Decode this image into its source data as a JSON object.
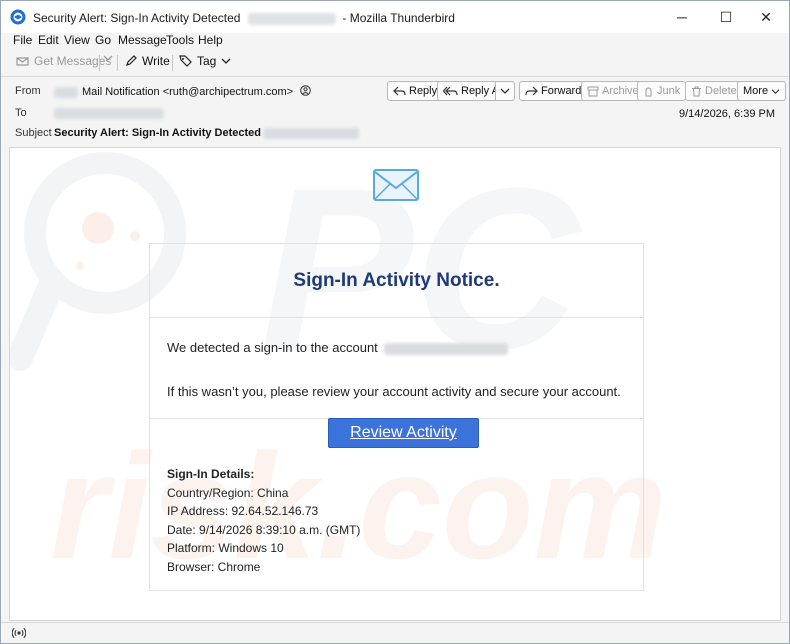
{
  "window": {
    "title_prefix": "Security Alert: Sign-In Activity Detected",
    "title_suffix": "- Mozilla Thunderbird",
    "controls": {
      "minimize": "─",
      "maximize": "☐",
      "close": "✕"
    }
  },
  "menubar": {
    "items": [
      "File",
      "Edit",
      "View",
      "Go",
      "Message",
      "Tools",
      "Help"
    ]
  },
  "toolbar": {
    "get_messages": "Get Messages",
    "write": "Write",
    "tag": "Tag"
  },
  "header": {
    "from_label": "From",
    "from_value": "Mail Notification <ruth@archipectrum.com>",
    "to_label": "To",
    "subject_label": "Subject",
    "subject_value": "Security Alert: Sign-In Activity Detected",
    "date": "9/14/2026, 6:39 PM",
    "buttons": {
      "reply": "Reply",
      "reply_all": "Reply All",
      "forward": "Forward",
      "archive": "Archive",
      "junk": "Junk",
      "delete": "Delete",
      "more": "More"
    }
  },
  "email": {
    "title": "Sign-In Activity Notice.",
    "line1": "We detected a sign-in to the account",
    "line2": "If this wasn’t you, please review your account activity and secure your account.",
    "button": "Review Activity",
    "details_heading": "Sign-In Details:",
    "details": [
      "Country/Region: China",
      "IP Address: 92.64.52.146.73",
      "Date: 9/14/2026 8:39:10 a.m. (GMT)",
      "Platform: Windows 10",
      "Browser: Chrome"
    ]
  },
  "colors": {
    "title_blue": "#1e3a78",
    "button_blue": "#3b73db",
    "watermark": "#f3d6cc"
  }
}
